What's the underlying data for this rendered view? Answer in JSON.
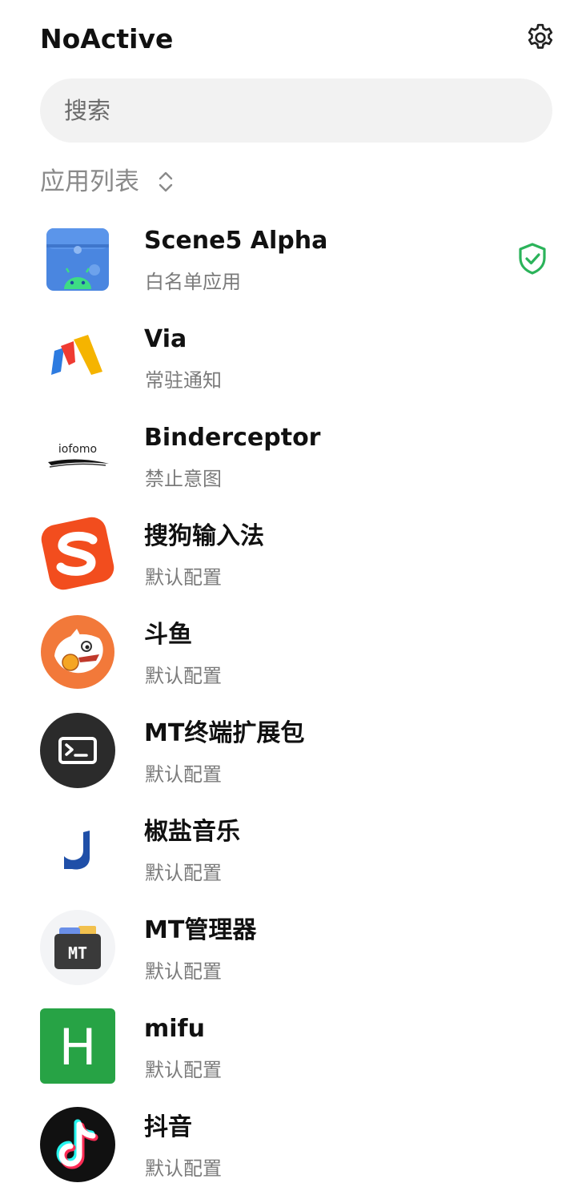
{
  "header": {
    "title": "NoActive",
    "settings_icon": "gear-icon"
  },
  "search": {
    "placeholder": "搜索"
  },
  "section": {
    "label": "应用列表",
    "sort_icon": "sort-updown-icon"
  },
  "apps": [
    {
      "name": "Scene5 Alpha",
      "status": "白名单应用",
      "icon": "scene-icon",
      "badge": "shield-check-icon",
      "badge_color": "#2bb35a"
    },
    {
      "name": "Via",
      "status": "常驻通知",
      "icon": "via-icon"
    },
    {
      "name": "Binderceptor",
      "status": "禁止意图",
      "icon": "iofomo-icon",
      "icon_text": "iofomo"
    },
    {
      "name": "搜狗输入法",
      "status": "默认配置",
      "icon": "sogou-icon"
    },
    {
      "name": "斗鱼",
      "status": "默认配置",
      "icon": "douyu-icon"
    },
    {
      "name": "MT终端扩展包",
      "status": "默认配置",
      "icon": "terminal-icon"
    },
    {
      "name": "椒盐音乐",
      "status": "默认配置",
      "icon": "salt-music-icon"
    },
    {
      "name": "MT管理器",
      "status": "默认配置",
      "icon": "mt-manager-icon",
      "icon_text": "MT"
    },
    {
      "name": "mifu",
      "status": "默认配置",
      "icon": "mifu-icon",
      "icon_text": "H"
    },
    {
      "name": "抖音",
      "status": "默认配置",
      "icon": "douyin-icon"
    }
  ]
}
